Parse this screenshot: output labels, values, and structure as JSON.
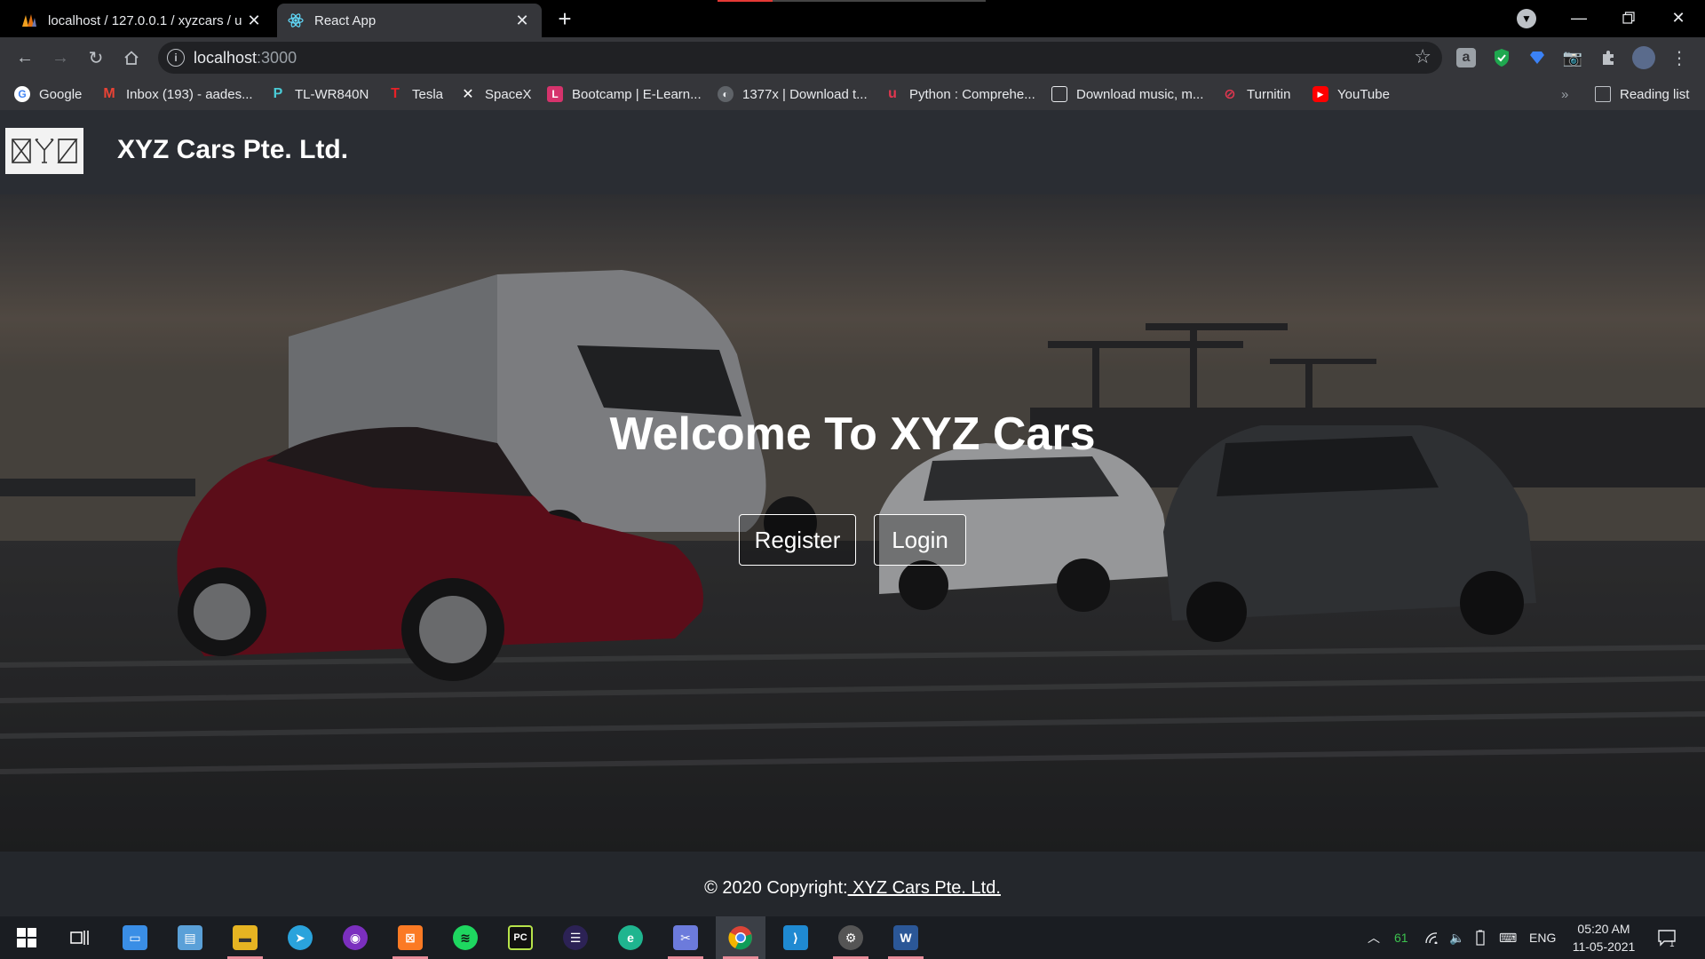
{
  "browser": {
    "tabs": [
      {
        "title": "localhost / 127.0.0.1 / xyzcars / u",
        "icon": "phpmyadmin-icon",
        "active": false
      },
      {
        "title": "React App",
        "icon": "react-icon",
        "active": true
      }
    ],
    "new_tab_label": "+",
    "address": {
      "host": "localhost",
      "port": ":3000"
    },
    "bookmarks": [
      {
        "label": "Google",
        "icon": "google-icon",
        "color": "#4285f4"
      },
      {
        "label": "Inbox (193) - aades...",
        "icon": "gmail-icon",
        "color": "#ea4335"
      },
      {
        "label": "TL-WR840N",
        "icon": "tplink-icon",
        "color": "#4acbd6"
      },
      {
        "label": "Tesla",
        "icon": "tesla-icon",
        "color": "#e82127"
      },
      {
        "label": "SpaceX",
        "icon": "spacex-icon",
        "color": "#ffffff"
      },
      {
        "label": "Bootcamp | E-Learn...",
        "icon": "bootcamp-icon",
        "color": "#d6336c"
      },
      {
        "label": "1377x | Download t...",
        "icon": "globe-icon",
        "color": "#9aa0a6"
      },
      {
        "label": "Python : Comprehe...",
        "icon": "udemy-icon",
        "color": "#e2364f"
      },
      {
        "label": "Download music, m...",
        "icon": "monitor-icon",
        "color": "#e8eaed"
      },
      {
        "label": "Turnitin",
        "icon": "turnitin-icon",
        "color": "#e2364f"
      },
      {
        "label": "YouTube",
        "icon": "youtube-icon",
        "color": "#ff0000"
      }
    ],
    "more_bookmarks": "»",
    "reading_list": "Reading list"
  },
  "app": {
    "logo_text": "XYZ",
    "brand": "XYZ Cars Pte. Ltd.",
    "hero_title": "Welcome To XYZ Cars",
    "register_label": "Register",
    "login_label": "Login",
    "footer_prefix": "© 2020 Copyright:",
    "footer_link": " XYZ Cars Pte. Ltd."
  },
  "taskbar": {
    "apps": [
      "start-icon",
      "task-view-icon",
      "this-pc-icon",
      "control-panel-icon",
      "file-explorer-icon",
      "telegram-icon",
      "podcast-icon",
      "xampp-icon",
      "spotify-icon",
      "pycharm-icon",
      "eclipse-icon",
      "edge-icon",
      "snip-icon",
      "chrome-icon",
      "vscode-icon",
      "settings-icon",
      "word-icon"
    ],
    "battery": "61",
    "language": "ENG",
    "time": "05:20 AM",
    "date": "11-05-2021",
    "notifications": "1"
  }
}
